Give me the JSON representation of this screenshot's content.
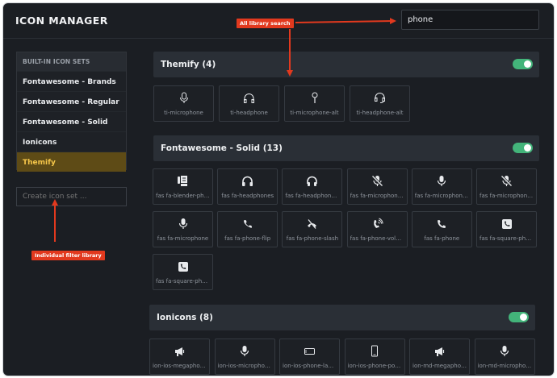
{
  "app": {
    "title": "ICON MANAGER"
  },
  "search": {
    "value": "phone"
  },
  "sidebar": {
    "header": "BUILT-IN ICON SETS",
    "items": [
      {
        "label": "Fontawesome - Brands"
      },
      {
        "label": "Fontawesome - Regular"
      },
      {
        "label": "Fontawesome - Solid"
      },
      {
        "label": "Ionicons"
      },
      {
        "label": "Themify"
      }
    ],
    "active_index": 4,
    "create_placeholder": "Create icon set ..."
  },
  "sections": [
    {
      "title": "Themify (4)",
      "enabled": true,
      "icons": [
        {
          "label": "ti-microphone",
          "icon": "microphone-outline-icon"
        },
        {
          "label": "ti-headphone",
          "icon": "headphone-outline-icon"
        },
        {
          "label": "ti-microphone-alt",
          "icon": "microphone-alt-outline-icon"
        },
        {
          "label": "ti-headphone-alt",
          "icon": "headset-outline-icon"
        }
      ]
    },
    {
      "title": "Fontawesome - Solid (13)",
      "enabled": true,
      "icons": [
        {
          "label": "fas fa-blender-phone",
          "icon": "blender-phone-icon"
        },
        {
          "label": "fas fa-headphones",
          "icon": "headphones-icon"
        },
        {
          "label": "fas fa-headphones-alt",
          "icon": "headphones-alt-icon"
        },
        {
          "label": "fas fa-microphone-slash",
          "icon": "microphone-slash-icon"
        },
        {
          "label": "fas fa-microphone-alt",
          "icon": "microphone-alt-icon"
        },
        {
          "label": "fas fa-microphone-alt-slash",
          "icon": "microphone-alt-slash-icon"
        },
        {
          "label": "fas fa-microphone",
          "icon": "microphone-icon"
        },
        {
          "label": "fas fa-phone-flip",
          "icon": "phone-flip-icon"
        },
        {
          "label": "fas fa-phone-slash",
          "icon": "phone-slash-icon"
        },
        {
          "label": "fas fa-phone-volume",
          "icon": "phone-volume-icon"
        },
        {
          "label": "fas fa-phone",
          "icon": "phone-icon"
        },
        {
          "label": "fas fa-square-phone",
          "icon": "square-phone-icon"
        },
        {
          "label": "fas fa-square-phone-flip",
          "icon": "square-phone-flip-icon"
        }
      ]
    },
    {
      "title": "Ionicons (8)",
      "enabled": true,
      "icons": [
        {
          "label": "ion-ios-megaphone",
          "icon": "megaphone-icon"
        },
        {
          "label": "ion-ios-microphone",
          "icon": "microphone-icon"
        },
        {
          "label": "ion-ios-phone-landscape",
          "icon": "phone-landscape-icon"
        },
        {
          "label": "ion-ios-phone-portrait",
          "icon": "phone-portrait-icon"
        },
        {
          "label": "ion-md-megaphone",
          "icon": "megaphone-icon"
        },
        {
          "label": "ion-md-microphone",
          "icon": "microphone-icon"
        }
      ]
    }
  ],
  "annotations": {
    "search": "All library search",
    "filter": "Individual filter library"
  },
  "colors": {
    "background": "#1b1e23",
    "section_bar": "#2a2f36",
    "active_item": "#5e4b16",
    "active_text": "#f5c64a",
    "toggle_on": "#43b47a",
    "annotation": "#e2391e"
  }
}
